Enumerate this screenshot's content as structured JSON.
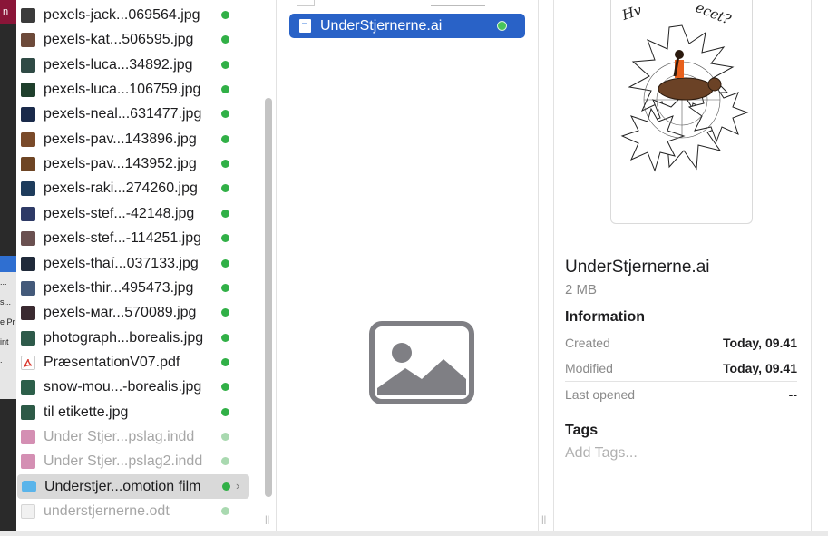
{
  "background_window": {
    "top_text": "n",
    "snippets": [
      "...",
      "s...",
      "e Pr",
      "int",
      "."
    ]
  },
  "column1": {
    "items": [
      {
        "name": "pexels-jack...069564.jpg",
        "icon": "image-thumbnail-icon",
        "dim": false,
        "color": "#3b3b3b"
      },
      {
        "name": "pexels-kat...506595.jpg",
        "icon": "image-thumbnail-icon",
        "dim": false,
        "color": "#6d4a3a"
      },
      {
        "name": "pexels-luca...34892.jpg",
        "icon": "image-thumbnail-icon",
        "dim": false,
        "color": "#2f4a45"
      },
      {
        "name": "pexels-luca...106759.jpg",
        "icon": "image-thumbnail-icon",
        "dim": false,
        "color": "#1f3f2c"
      },
      {
        "name": "pexels-neal...631477.jpg",
        "icon": "image-thumbnail-icon",
        "dim": false,
        "color": "#1a2a4a"
      },
      {
        "name": "pexels-pav...143896.jpg",
        "icon": "image-thumbnail-icon",
        "dim": false,
        "color": "#7a4a2a"
      },
      {
        "name": "pexels-pav...143952.jpg",
        "icon": "image-thumbnail-icon",
        "dim": false,
        "color": "#6e4524"
      },
      {
        "name": "pexels-raki...274260.jpg",
        "icon": "image-thumbnail-icon",
        "dim": false,
        "color": "#1e3c5c"
      },
      {
        "name": "pexels-stef...-42148.jpg",
        "icon": "image-thumbnail-icon",
        "dim": false,
        "color": "#2e3a66"
      },
      {
        "name": "pexels-stef...-114251.jpg",
        "icon": "image-thumbnail-icon",
        "dim": false,
        "color": "#6a5050"
      },
      {
        "name": "pexels-thaí...037133.jpg",
        "icon": "image-thumbnail-icon",
        "dim": false,
        "color": "#202a3a"
      },
      {
        "name": "pexels-thir...495473.jpg",
        "icon": "image-thumbnail-icon",
        "dim": false,
        "color": "#445a7a"
      },
      {
        "name": "pexels-мar...570089.jpg",
        "icon": "image-thumbnail-icon",
        "dim": false,
        "color": "#3a2a30"
      },
      {
        "name": "photograph...borealis.jpg",
        "icon": "image-thumbnail-icon",
        "dim": false,
        "color": "#2e5a4a"
      },
      {
        "name": "PræsentationV07.pdf",
        "icon": "pdf-icon",
        "dim": false,
        "color": "#d9362b"
      },
      {
        "name": "snow-mou...-borealis.jpg",
        "icon": "image-thumbnail-icon",
        "dim": false,
        "color": "#2c5f4a"
      },
      {
        "name": "til etikette.jpg",
        "icon": "image-thumbnail-icon",
        "dim": false,
        "color": "#2d5a47"
      },
      {
        "name": "Under Stjer...pslag.indd",
        "icon": "indesign-icon",
        "dim": true,
        "color": "#c56a9a"
      },
      {
        "name": "Under Stjer...pslag2.indd",
        "icon": "indesign-icon",
        "dim": true,
        "color": "#c56a9a"
      },
      {
        "name": "Understjer...omotion film",
        "icon": "folder-icon",
        "dim": false,
        "color": "#5ab4ea",
        "selected": true
      },
      {
        "name": "understjernerne.odt",
        "icon": "document-icon",
        "dim": true,
        "color": "#c9c9c9"
      }
    ]
  },
  "column2": {
    "selected_file": "UnderStjernerne.ai",
    "placeholder_icon": "image-placeholder-icon"
  },
  "preview": {
    "artwork_text": "Hv... ...cet?",
    "file_name": "UnderStjernerne.ai",
    "file_size": "2 MB",
    "information_heading": "Information",
    "info_rows": [
      {
        "key": "Created",
        "value": "Today, 09.41"
      },
      {
        "key": "Modified",
        "value": "Today, 09.41"
      },
      {
        "key": "Last opened",
        "value": "--"
      }
    ],
    "tags_heading": "Tags",
    "tags_placeholder": "Add Tags..."
  },
  "colors": {
    "selection_blue": "#2962c7",
    "sync_green": "#31b047",
    "placeholder_gray": "#7f7f84"
  }
}
